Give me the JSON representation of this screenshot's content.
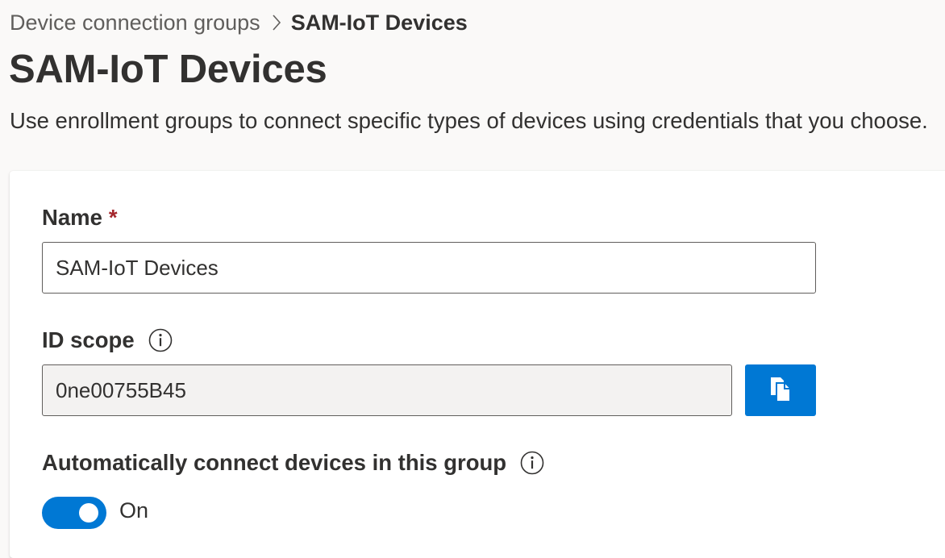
{
  "breadcrumb": {
    "parent": "Device connection groups",
    "current": "SAM-IoT Devices"
  },
  "page": {
    "title": "SAM-IoT Devices",
    "description": "Use enrollment groups to connect specific types of devices using credentials that you choose."
  },
  "form": {
    "name": {
      "label": "Name",
      "required_marker": "*",
      "value": "SAM-IoT Devices"
    },
    "id_scope": {
      "label": "ID scope",
      "value": "0ne00755B45",
      "copy_icon": "copy-icon"
    },
    "auto_connect": {
      "label": "Automatically connect devices in this group",
      "state_label": "On",
      "enabled": true
    }
  },
  "colors": {
    "accent": "#0078d4",
    "required": "#a4262c",
    "page_background": "#faf9f8"
  }
}
